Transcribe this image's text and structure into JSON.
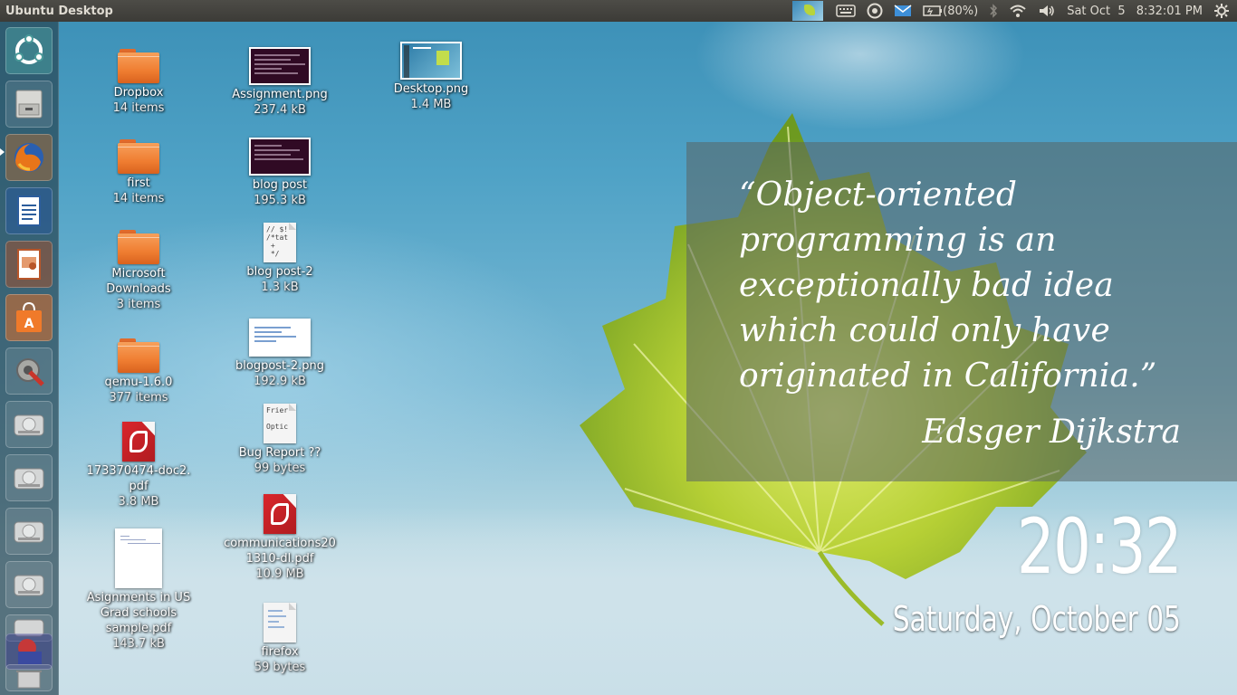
{
  "panel": {
    "title": "Ubuntu Desktop",
    "battery": "(80%)",
    "date": "Sat Oct  5",
    "time": "8:32:01 PM"
  },
  "launcher": {
    "items": [
      "dash-home",
      "files",
      "firefox",
      "libreoffice-writer",
      "libreoffice-impress",
      "ubuntu-software-center",
      "system-settings",
      "drive",
      "drive",
      "drive",
      "drive",
      "workspaces",
      "trash"
    ]
  },
  "desktop": {
    "col1": [
      {
        "name": "Dropbox",
        "meta": "14 items",
        "type": "folder"
      },
      {
        "name": "first",
        "meta": "14 items",
        "type": "folder"
      },
      {
        "name": "Microsoft Downloads",
        "meta": "3 items",
        "type": "folder"
      },
      {
        "name": "qemu-1.6.0",
        "meta": "377 items",
        "type": "folder"
      },
      {
        "name": "173370474-doc2.pdf",
        "meta": "3.8 MB",
        "type": "pdf"
      },
      {
        "name": "Asignments in US Grad schools sample.pdf",
        "meta": "143.7 kB",
        "type": "doc"
      }
    ],
    "col2": [
      {
        "name": "Assignment.png",
        "meta": "237.4 kB",
        "type": "image"
      },
      {
        "name": "blog post",
        "meta": "195.3 kB",
        "type": "image"
      },
      {
        "name": "blog post-2",
        "meta": "1.3 kB",
        "type": "text",
        "preview": "// $!\n/*tat\n +\n */"
      },
      {
        "name": "blogpost-2.png",
        "meta": "192.9 kB",
        "type": "image"
      },
      {
        "name": "Bug Report ??",
        "meta": "99 bytes",
        "type": "text",
        "preview": "Frier\n\nOptic"
      },
      {
        "name": "communications201310-dl.pdf",
        "meta": "10.9 MB",
        "type": "pdf"
      },
      {
        "name": "firefox",
        "meta": "59 bytes",
        "type": "text",
        "preview": ""
      }
    ],
    "col3": [
      {
        "name": "Desktop.png",
        "meta": "1.4 MB",
        "type": "image"
      }
    ]
  },
  "quote": {
    "text": "“Object-oriented programming is an exceptionally bad idea which could only have originated in California.”",
    "author": "Edsger Dijkstra"
  },
  "clock": {
    "time": "20:32",
    "date": "Saturday, October 05"
  }
}
